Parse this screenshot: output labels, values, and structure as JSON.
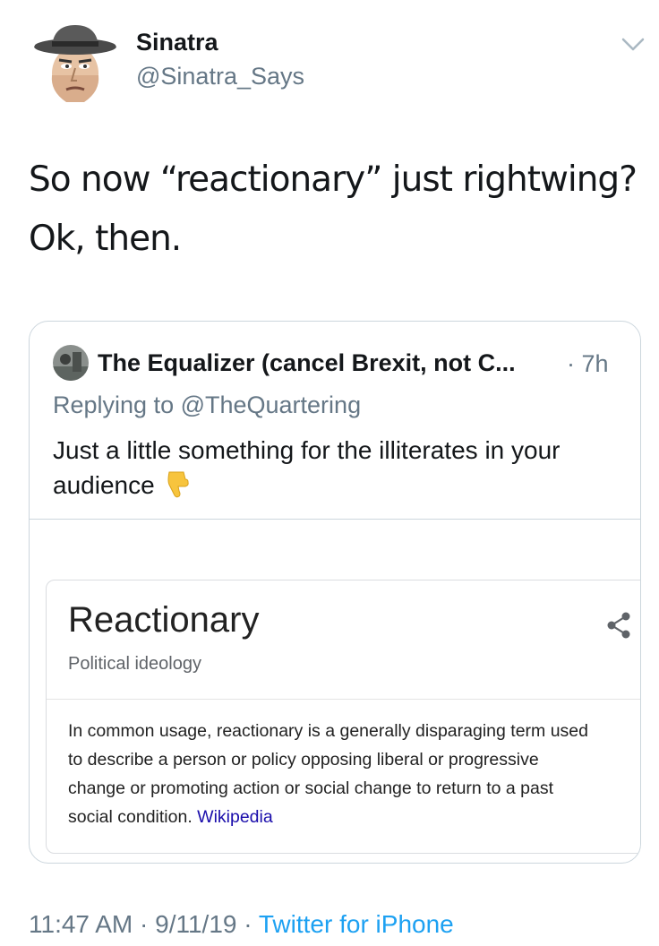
{
  "author": {
    "name": "Sinatra",
    "handle": "@Sinatra_Says"
  },
  "tweet": {
    "lines": [
      "So now “reactionary” just rightwing?",
      "Ok, then."
    ]
  },
  "quoted_tweet": {
    "author_name": "The Equalizer (cancel Brexit, not C...",
    "time": "· 7h",
    "replying_to": "Replying to @TheQuartering",
    "body_lines": [
      "Just a little something for the illiterates in your",
      "audience"
    ]
  },
  "knowledge_card": {
    "title": "Reactionary",
    "subtitle": "Political ideology",
    "description_lines": [
      "In common usage, reactionary is a generally disparaging term used",
      "to describe a person or policy opposing liberal or progressive",
      "change or promoting action or social change to return to a past",
      "social condition."
    ],
    "source_link": "Wikipedia"
  },
  "meta": {
    "time": "11:47 AM",
    "separator": "·",
    "date": "9/11/19",
    "source": "Twitter for iPhone"
  },
  "colors": {
    "link_blue": "#1da1f2",
    "secondary_gray": "#657786",
    "border": "#ccd6dd",
    "wiki_link": "#1a0dab"
  },
  "icons": [
    "avatar-cartoon-icon",
    "chevron-down-icon",
    "pointing-down-emoji-icon",
    "share-icon"
  ]
}
